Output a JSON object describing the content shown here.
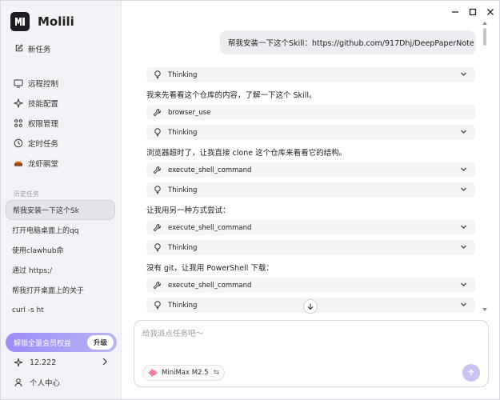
{
  "app": {
    "name": "Molili"
  },
  "sidebar": {
    "new_task": "新任务",
    "nav": [
      {
        "label": "远程控制",
        "icon": "remote-control-icon"
      },
      {
        "label": "技能配置",
        "icon": "skill-icon"
      },
      {
        "label": "权限管理",
        "icon": "permission-icon"
      },
      {
        "label": "定时任务",
        "icon": "clock-icon"
      },
      {
        "label": "龙虾鹂堂",
        "icon": "lobster-icon"
      }
    ],
    "history_label": "历史任务",
    "history": [
      "帮我安装一下这个Sk",
      "打开电脑桌面上的qq",
      "使用clawhub命",
      "通过 https:/",
      "帮我打开桌面上的关于",
      "curl -s ht"
    ],
    "upgrade_text": "解锁全量会员权益",
    "upgrade_btn": "升级",
    "credits": "12.222",
    "profile": "个人中心"
  },
  "chat": {
    "user_message": "帮我安装一下这个Skill：https://github.com/917Dhj/DeepPaperNote",
    "thinking": "Thinking",
    "browser_use": "browser_use",
    "exec": "execute_shell_command",
    "msg1": "我来先看看这个仓库的内容，了解一下这个 Skill。",
    "msg2": "浏览器超时了，让我直接 clone 这个仓库来看看它的结构。",
    "msg3": "让我用另一种方式尝试：",
    "msg4": "没有 git，让我用 PowerShell 下载："
  },
  "composer": {
    "placeholder": "给我派点任务吧～",
    "model": "MiniMax M2.5",
    "swap": "⇆"
  }
}
